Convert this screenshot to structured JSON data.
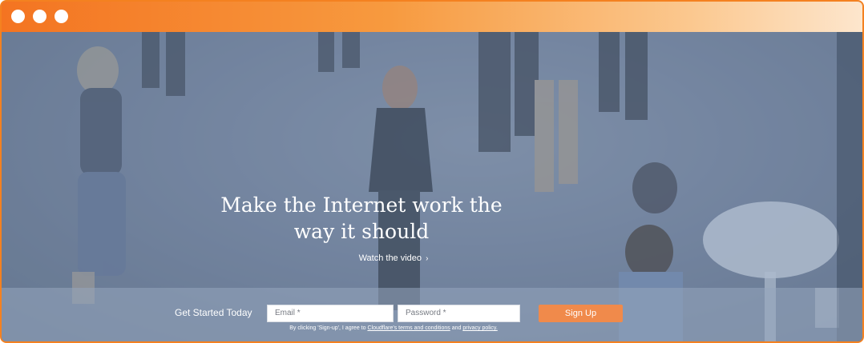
{
  "window": {
    "titlebar_controls": [
      "circle",
      "circle",
      "circle"
    ]
  },
  "hero": {
    "headline_line1": "Make the Internet work the",
    "headline_line2": "way it should",
    "watch_video_label": "Watch the video",
    "watch_video_chevron": "›"
  },
  "signup": {
    "label": "Get Started Today",
    "email_placeholder": "Email *",
    "password_placeholder": "Password *",
    "button_label": "Sign Up",
    "terms_prefix": "By clicking 'Sign-up', I agree to",
    "terms_link": "Cloudflare's terms and conditions",
    "terms_and": "and",
    "privacy_link": "privacy policy."
  },
  "colors": {
    "frame_orange": "#f48120",
    "button_orange": "#f08a4b",
    "overlay_blue": "#6e7f98"
  }
}
